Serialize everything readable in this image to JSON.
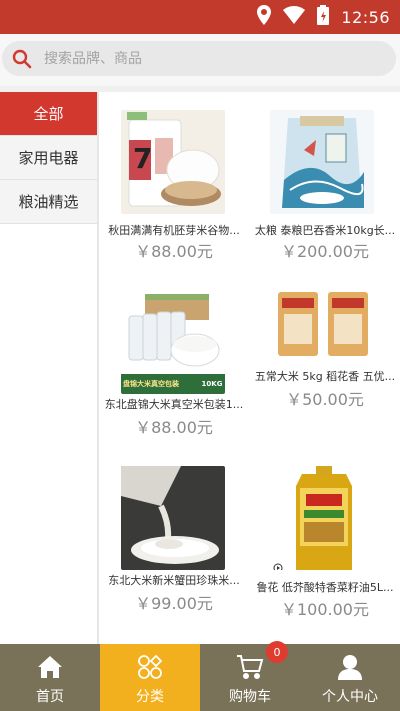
{
  "status_bar": {
    "time": "12:56",
    "icons": [
      "location-icon",
      "wifi-icon",
      "battery-icon"
    ]
  },
  "search": {
    "placeholder": "搜索品牌、商品"
  },
  "sidebar": {
    "items": [
      {
        "label": "全部",
        "active": true
      },
      {
        "label": "家用电器",
        "active": false
      },
      {
        "label": "粮油精选",
        "active": false
      }
    ]
  },
  "products": [
    {
      "name": "秋田满满有机胚芽米谷物...",
      "price": "￥88.00元"
    },
    {
      "name": "太粮 泰粮巴吞香米10kg长...",
      "price": "￥200.00元"
    },
    {
      "name": "东北盘锦大米真空米包装1...",
      "price": "￥88.00元",
      "image_caption": "盘锦大米真空包装",
      "image_weight": "10KG"
    },
    {
      "name": "五常大米 5kg 稻花香 五优...",
      "price": "￥50.00元"
    },
    {
      "name": "东北大米新米蟹田珍珠米...",
      "price": "￥99.00元"
    },
    {
      "name": "鲁花 低芥酸特香菜籽油5L...",
      "price": "￥100.00元"
    }
  ],
  "tabbar": {
    "tabs": [
      {
        "label": "首页",
        "icon": "home-icon",
        "active": false
      },
      {
        "label": "分类",
        "icon": "category-icon",
        "active": true
      },
      {
        "label": "购物车",
        "icon": "cart-icon",
        "active": false,
        "badge": "0"
      },
      {
        "label": "个人中心",
        "icon": "user-icon",
        "active": false
      }
    ]
  },
  "colors": {
    "status_bar": "#c23a2c",
    "active_sidebar": "#d3382f",
    "tabbar": "#7a7258",
    "tab_active": "#f3b01e",
    "badge": "#e03b2f"
  }
}
